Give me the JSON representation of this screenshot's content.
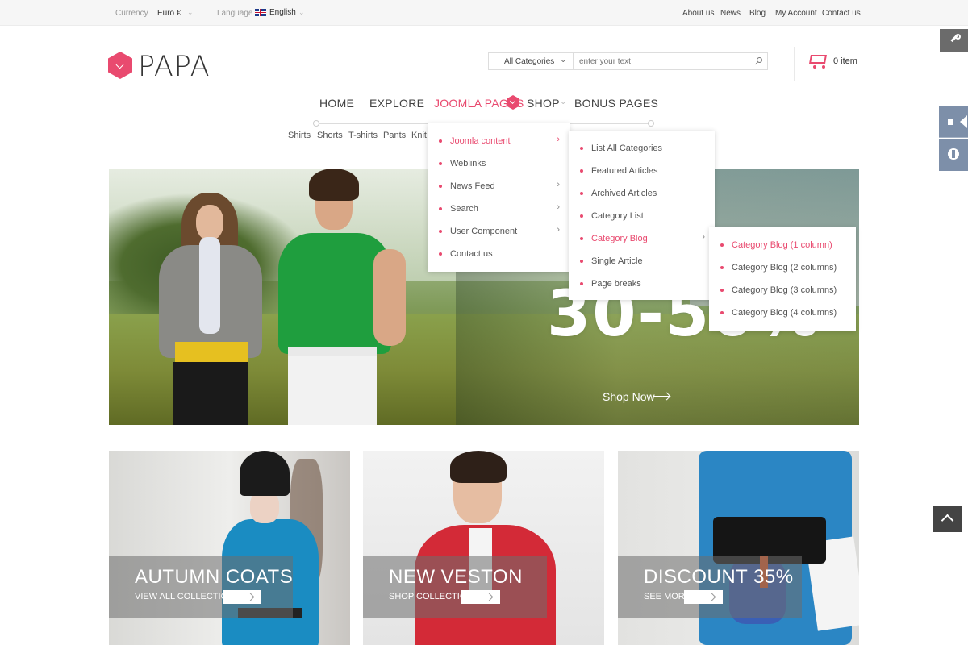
{
  "topbar": {
    "currency_label": "Currency",
    "currency_value": "Euro €",
    "language_label": "Language",
    "language_value": "English",
    "links": [
      "About us",
      "News",
      "Blog",
      "My Account",
      "Contact us"
    ]
  },
  "header": {
    "logo_text": "PAPA",
    "search_category": "All Categories",
    "search_placeholder": "enter your text",
    "cart_label": "0 item"
  },
  "nav": {
    "items": [
      "HOME",
      "EXPLORE",
      "JOOMLA PAGES",
      "SHOP",
      "BONUS PAGES"
    ],
    "active": "JOOMLA PAGES",
    "sub_items": [
      "Shirts",
      "Shorts",
      "T-shirts",
      "Pants",
      "Knit"
    ]
  },
  "dropdowns": {
    "level1": [
      {
        "label": "Joomla content",
        "selected": true,
        "chevron": true
      },
      {
        "label": "Weblinks",
        "selected": false,
        "chevron": false
      },
      {
        "label": "News Feed",
        "selected": false,
        "chevron": true
      },
      {
        "label": "Search",
        "selected": false,
        "chevron": true
      },
      {
        "label": "User Component",
        "selected": false,
        "chevron": true
      },
      {
        "label": "Contact us",
        "selected": false,
        "chevron": false
      }
    ],
    "level2": [
      {
        "label": "List All Categories",
        "selected": false,
        "chevron": false
      },
      {
        "label": "Featured Articles",
        "selected": false,
        "chevron": false
      },
      {
        "label": "Archived Articles",
        "selected": false,
        "chevron": false
      },
      {
        "label": "Category List",
        "selected": false,
        "chevron": false
      },
      {
        "label": "Category Blog",
        "selected": true,
        "chevron": true
      },
      {
        "label": "Single Article",
        "selected": false,
        "chevron": false
      },
      {
        "label": "Page breaks",
        "selected": false,
        "chevron": false
      }
    ],
    "level3": [
      {
        "label": "Category Blog (1 column)",
        "selected": true
      },
      {
        "label": "Category Blog (2 columns)",
        "selected": false
      },
      {
        "label": "Category Blog (3 columns)",
        "selected": false
      },
      {
        "label": "Category Blog (4 columns)",
        "selected": false
      }
    ]
  },
  "hero": {
    "headline": "30-50%",
    "cta": "Shop Now"
  },
  "tiles": [
    {
      "title": "AUTUMN COATS",
      "subtitle": "VIEW ALL COLLECTION"
    },
    {
      "title": "NEW VESTON",
      "subtitle": "SHOP COLLECTION"
    },
    {
      "title": "DISCOUNT 35%",
      "subtitle": "SEE MORE"
    }
  ],
  "icons": {
    "side": [
      "wrench-icon",
      "megaphone-icon",
      "info-icon"
    ],
    "back_to_top": "chevron-up-icon",
    "cart": "cart-icon",
    "search": "search-icon"
  },
  "colors": {
    "accent": "#e94a6f",
    "side_widget": "#7d8fa9",
    "top_button": "#444444"
  }
}
